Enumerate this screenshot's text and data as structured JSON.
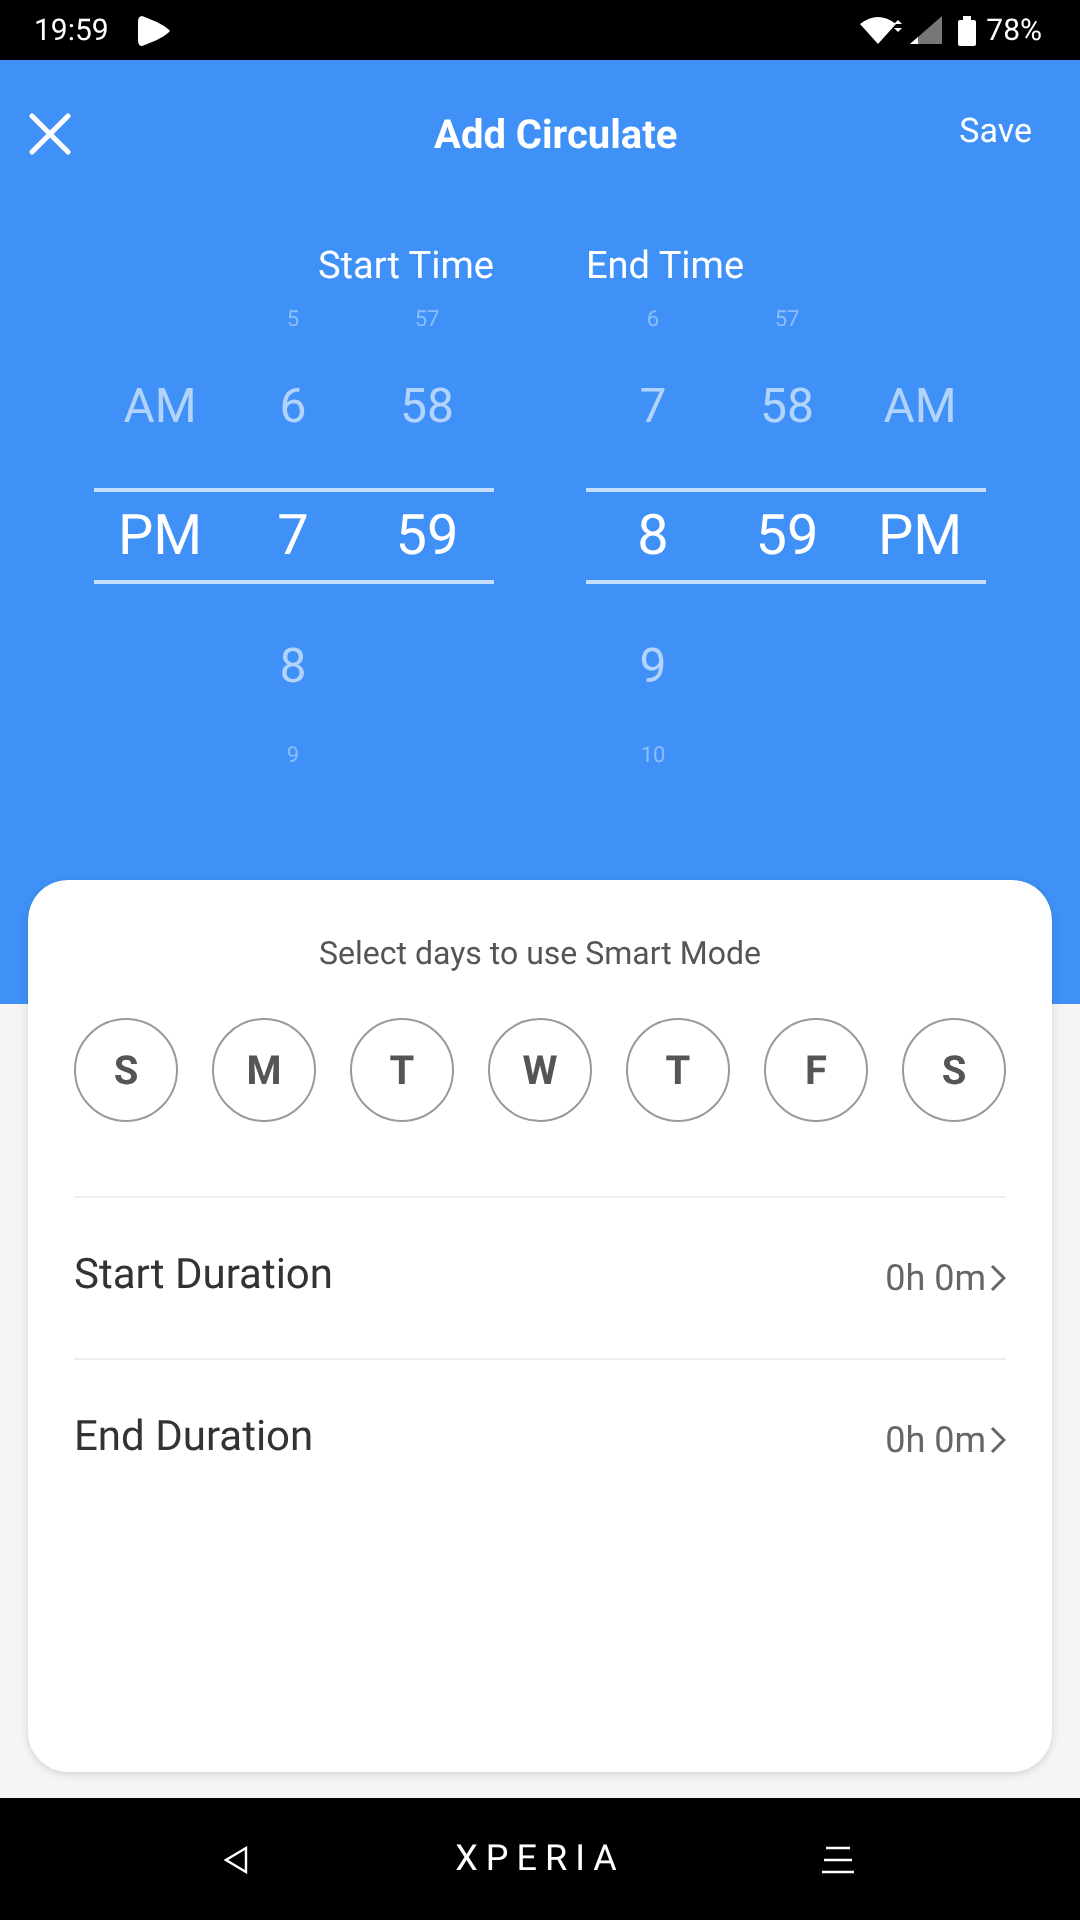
{
  "status_bar": {
    "time": "19:59",
    "battery": "78%"
  },
  "header": {
    "title": "Add Circulate",
    "save": "Save"
  },
  "pickers": [
    {
      "label": "Start Time",
      "columns": [
        {
          "kind": "ampm",
          "items": [
            {
              "text": "AM",
              "selected": false
            },
            {
              "text": "PM",
              "selected": true
            }
          ]
        },
        {
          "kind": "hour",
          "items": [
            {
              "text": "5",
              "selected": false
            },
            {
              "text": "6",
              "selected": false
            },
            {
              "text": "7",
              "selected": true
            },
            {
              "text": "8",
              "selected": false
            },
            {
              "text": "9",
              "selected": false
            }
          ]
        },
        {
          "kind": "minute",
          "items": [
            {
              "text": "57",
              "selected": false
            },
            {
              "text": "58",
              "selected": false
            },
            {
              "text": "59",
              "selected": true
            }
          ]
        }
      ]
    },
    {
      "label": "End Time",
      "columns": [
        {
          "kind": "hour",
          "items": [
            {
              "text": "6",
              "selected": false
            },
            {
              "text": "7",
              "selected": false
            },
            {
              "text": "8",
              "selected": true
            },
            {
              "text": "9",
              "selected": false
            },
            {
              "text": "10",
              "selected": false
            }
          ]
        },
        {
          "kind": "minute",
          "items": [
            {
              "text": "57",
              "selected": false
            },
            {
              "text": "58",
              "selected": false
            },
            {
              "text": "59",
              "selected": true
            }
          ]
        },
        {
          "kind": "ampm",
          "items": [
            {
              "text": "AM",
              "selected": false
            },
            {
              "text": "PM",
              "selected": true
            }
          ]
        }
      ]
    }
  ],
  "card": {
    "prompt": "Select days to use Smart Mode",
    "days": [
      {
        "label": "S",
        "selected": false
      },
      {
        "label": "M",
        "selected": false
      },
      {
        "label": "T",
        "selected": false
      },
      {
        "label": "W",
        "selected": false
      },
      {
        "label": "T",
        "selected": false
      },
      {
        "label": "F",
        "selected": false
      },
      {
        "label": "S",
        "selected": false
      }
    ],
    "rows": [
      {
        "label": "Start Duration",
        "value": "0h 0m"
      },
      {
        "label": "End Duration",
        "value": "0h 0m"
      }
    ]
  },
  "nav_bar": {
    "logo": "XPERIA"
  }
}
